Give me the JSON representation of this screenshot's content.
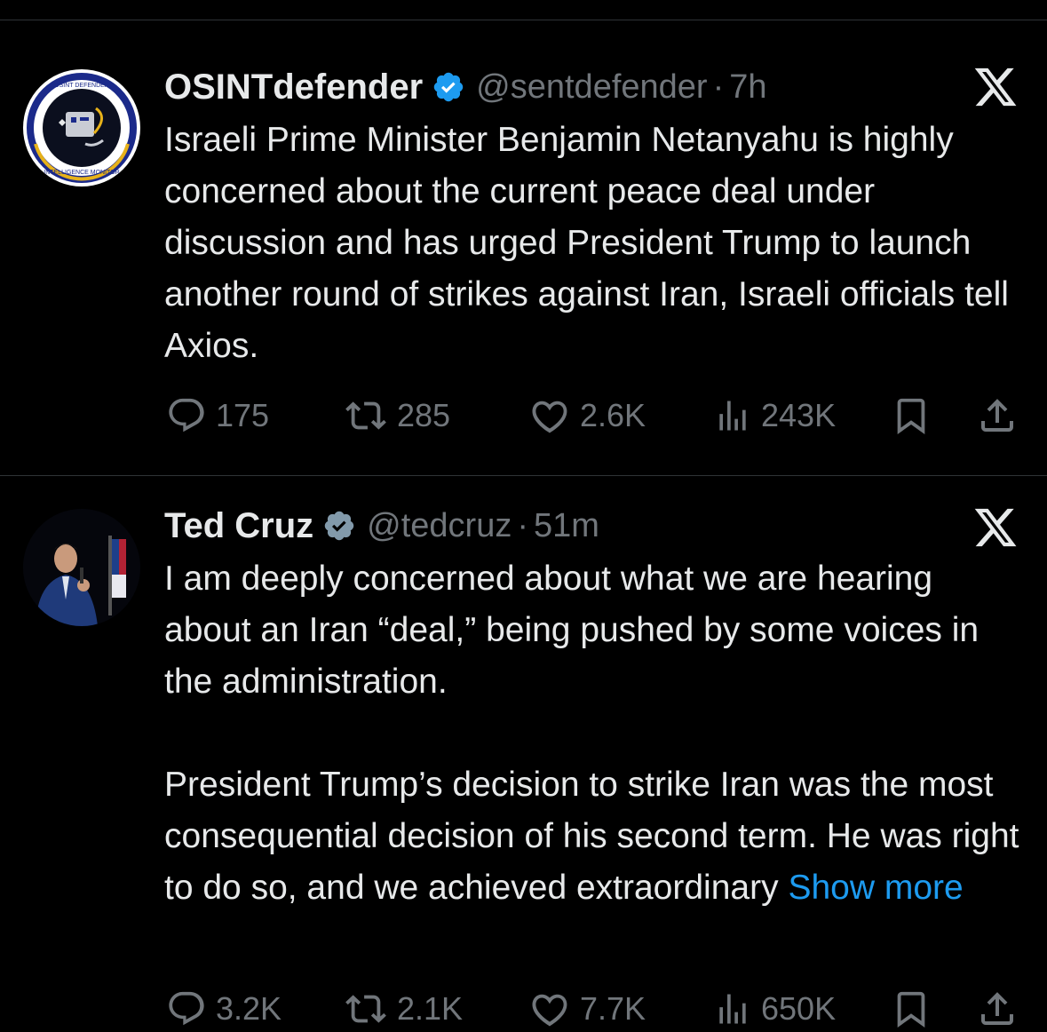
{
  "tweets": [
    {
      "name": "OSINTdefender",
      "handle": "@sentdefender",
      "separator": "·",
      "time": "7h",
      "avatar_text_top": "OSINT DEFENDER",
      "avatar_text_bottom": "INTELLIGENCE MONITOR",
      "body": [
        "Israeli Prime Minister Benjamin Netanyahu is highly concerned about the current peace deal under discussion and has urged President Trump to launch another round of strikes against Iran, Israeli officials tell Axios."
      ],
      "stats": {
        "replies": "175",
        "reposts": "285",
        "likes": "2.6K",
        "views": "243K"
      }
    },
    {
      "name": "Ted Cruz",
      "handle": "@tedcruz",
      "separator": "·",
      "time": "51m",
      "body": [
        "I am deeply concerned about what we are hearing about an Iran “deal,” being pushed by some voices in the administration.",
        "President Trump’s decision to strike Iran was the most consequential decision of his second term. He was right to do so, and we achieved extraordinary"
      ],
      "show_more": "Show more",
      "stats": {
        "replies": "3.2K",
        "reposts": "2.1K",
        "likes": "7.7K",
        "views": "650K"
      }
    }
  ],
  "icons": [
    "reply-icon",
    "repost-icon",
    "like-icon",
    "views-icon",
    "bookmark-icon",
    "share-icon",
    "x-logo-icon",
    "verified-badge-icon"
  ],
  "colors": {
    "background": "#000000",
    "text": "#e7e9ea",
    "muted": "#71767b",
    "link": "#1d9bf0",
    "verified": "#1d9bf0",
    "divider": "#2f3336"
  }
}
